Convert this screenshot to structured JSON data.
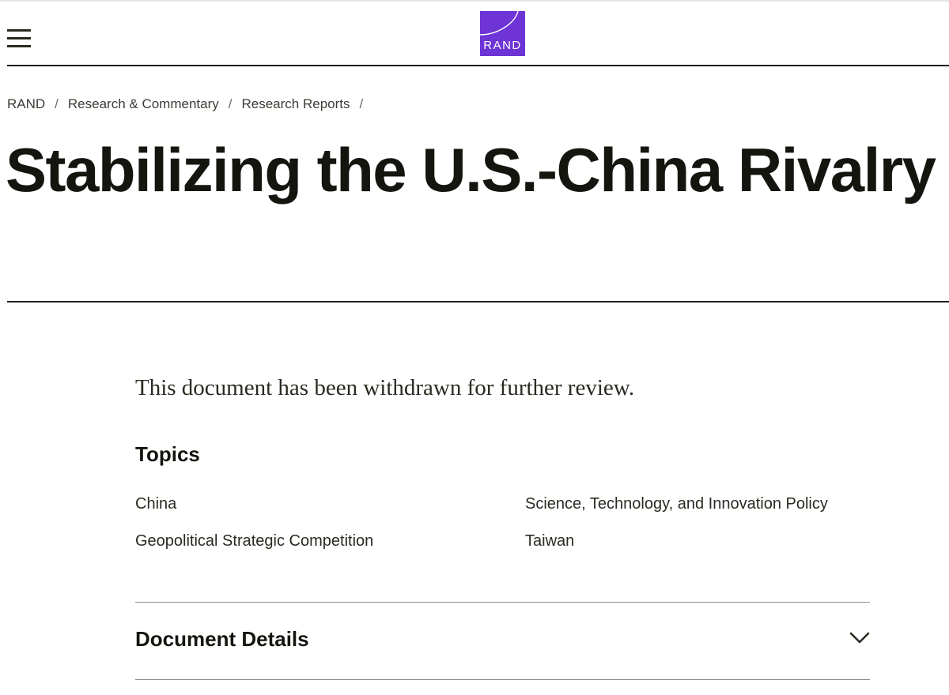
{
  "header": {
    "logo_text": "RAND",
    "logo_color": "#6e34d6"
  },
  "breadcrumb": {
    "items": [
      "RAND",
      "Research & Commentary",
      "Research Reports"
    ],
    "separator": "/"
  },
  "page": {
    "title": "Stabilizing the U.S.-China Rivalry",
    "notice": "This document has been withdrawn for further review."
  },
  "topics": {
    "heading": "Topics",
    "items": [
      "China",
      "Science, Technology, and Innovation Policy",
      "Geopolitical Strategic Competition",
      "Taiwan"
    ]
  },
  "details": {
    "label": "Document Details",
    "icon": "chevron-down-icon"
  }
}
